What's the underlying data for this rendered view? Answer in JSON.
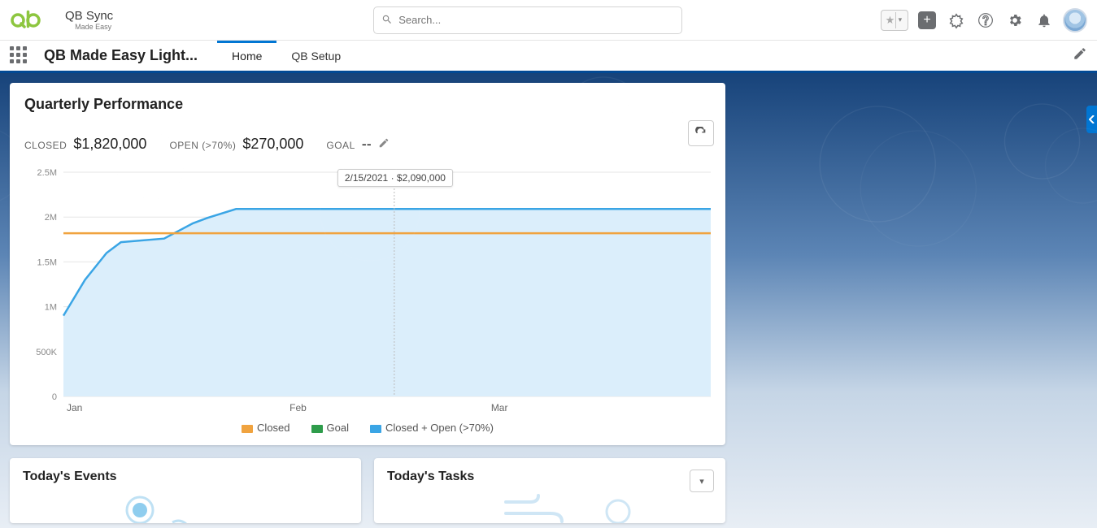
{
  "header": {
    "logo_name": "QB Sync",
    "logo_sub": "Made Easy",
    "search_placeholder": "Search..."
  },
  "nav": {
    "app_name": "QB Made Easy Light...",
    "tabs": [
      "Home",
      "QB Setup"
    ],
    "active_tab": 0
  },
  "perf": {
    "title": "Quarterly Performance",
    "closed_label": "CLOSED",
    "closed_value": "$1,820,000",
    "open_label": "OPEN (>70%)",
    "open_value": "$270,000",
    "goal_label": "GOAL",
    "goal_value": "--",
    "tooltip": "2/15/2021 · $2,090,000"
  },
  "legend": {
    "closed": "Closed",
    "goal": "Goal",
    "combo": "Closed + Open (>70%)"
  },
  "cards": {
    "events_title": "Today's Events",
    "tasks_title": "Today's Tasks"
  },
  "colors": {
    "closed": "#f0a33f",
    "goal": "#2e9c4b",
    "combo": "#3aa5e5",
    "area": "#dbeefb"
  },
  "chart_data": {
    "type": "area",
    "title": "Quarterly Performance",
    "xlabel": "",
    "ylabel": "",
    "x_ticks": [
      "Jan",
      "Feb",
      "Mar"
    ],
    "y_ticks": [
      "0",
      "500K",
      "1M",
      "1.5M",
      "2M",
      "2.5M"
    ],
    "ylim": [
      0,
      2500000
    ],
    "x_domain_days": 90,
    "series": [
      {
        "name": "Closed + Open (>70%)",
        "color": "#3aa5e5",
        "fill": "#dbeefb",
        "points": [
          {
            "day": 0,
            "value": 900000
          },
          {
            "day": 3,
            "value": 1300000
          },
          {
            "day": 6,
            "value": 1600000
          },
          {
            "day": 8,
            "value": 1720000
          },
          {
            "day": 14,
            "value": 1760000
          },
          {
            "day": 18,
            "value": 1930000
          },
          {
            "day": 20,
            "value": 1990000
          },
          {
            "day": 24,
            "value": 2090000
          },
          {
            "day": 90,
            "value": 2090000
          }
        ]
      },
      {
        "name": "Closed",
        "color": "#f0a33f",
        "constant_value": 1820000
      },
      {
        "name": "Goal",
        "color": "#2e9c4b",
        "constant_value": null
      }
    ],
    "hover": {
      "day": 46,
      "label": "2/15/2021",
      "value": 2090000,
      "value_label": "$2,090,000"
    },
    "legend_position": "bottom"
  }
}
